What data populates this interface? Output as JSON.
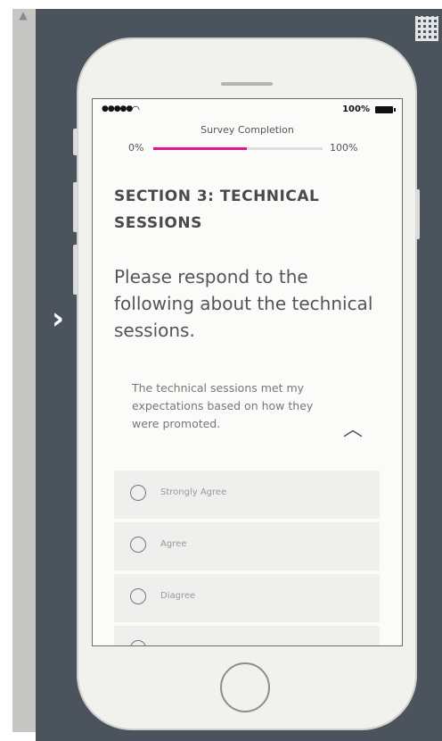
{
  "status_bar": {
    "signal": "●●●●●",
    "battery_percent": "100%"
  },
  "progress": {
    "title": "Survey Completion",
    "start_label": "0%",
    "end_label": "100%",
    "fill_fraction": 0.55,
    "fill_color": "#e0168a"
  },
  "section_title": "SECTION 3:  TECHNICAL SESSIONS",
  "question": "Please respond to the following about the technical sessions.",
  "statement": "The technical sessions met my expectations based on how they were promoted.",
  "options": [
    {
      "label": "Strongly Agree"
    },
    {
      "label": "Agree"
    },
    {
      "label": "Diagree"
    },
    {
      "label": ""
    }
  ],
  "icons": {
    "nav": "chevron-right-icon",
    "collapse": "chevron-up-icon",
    "scroll": "scroll-up-arrow-icon"
  }
}
